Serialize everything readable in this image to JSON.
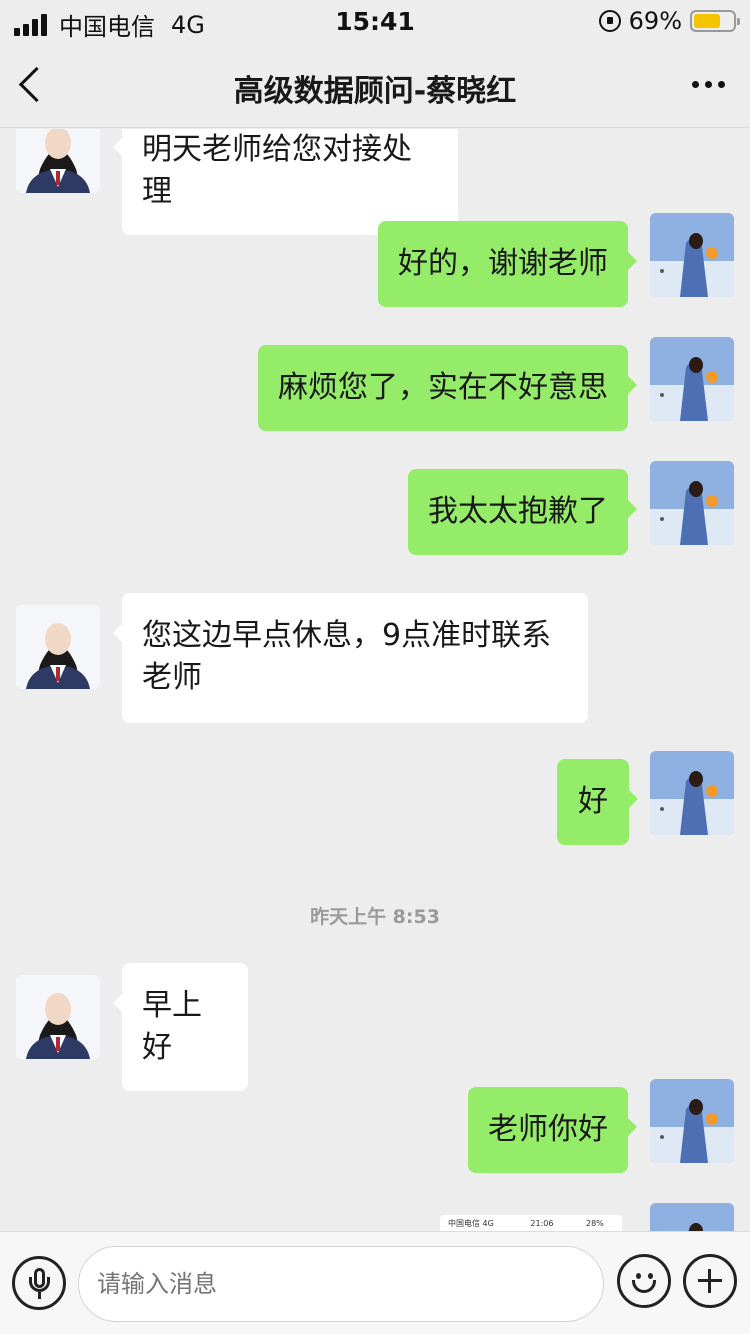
{
  "status_bar": {
    "carrier": "中国电信",
    "network": "4G",
    "time": "15:41",
    "battery": "69%",
    "battery_level": 0.69
  },
  "header": {
    "title": "高级数据顾问-蔡晓红"
  },
  "messages": [
    {
      "sender": "other",
      "text": "明天老师给您对接处理"
    },
    {
      "sender": "self",
      "text": "好的，谢谢老师"
    },
    {
      "sender": "self",
      "text": "麻烦您了，实在不好意思"
    },
    {
      "sender": "self",
      "text": "我太太抱歉了"
    },
    {
      "sender": "other",
      "text_line1": "您这边早点休息，9点准时联系",
      "text_line2": "老师"
    },
    {
      "sender": "self",
      "text": "好"
    },
    {
      "type": "timestamp",
      "text": "昨天上午 8:53"
    },
    {
      "sender": "other",
      "text": "早上好"
    },
    {
      "sender": "self",
      "text": "老师你好"
    },
    {
      "sender": "self",
      "type": "image",
      "text_carrier": "中国电信  4G",
      "text_time": "21:06",
      "text_battery": "28%"
    }
  ],
  "input": {
    "placeholder": "请输入消息"
  },
  "colors": {
    "self_bubble": "#95ec69",
    "other_bubble": "#ffffff",
    "background": "#ededed"
  }
}
